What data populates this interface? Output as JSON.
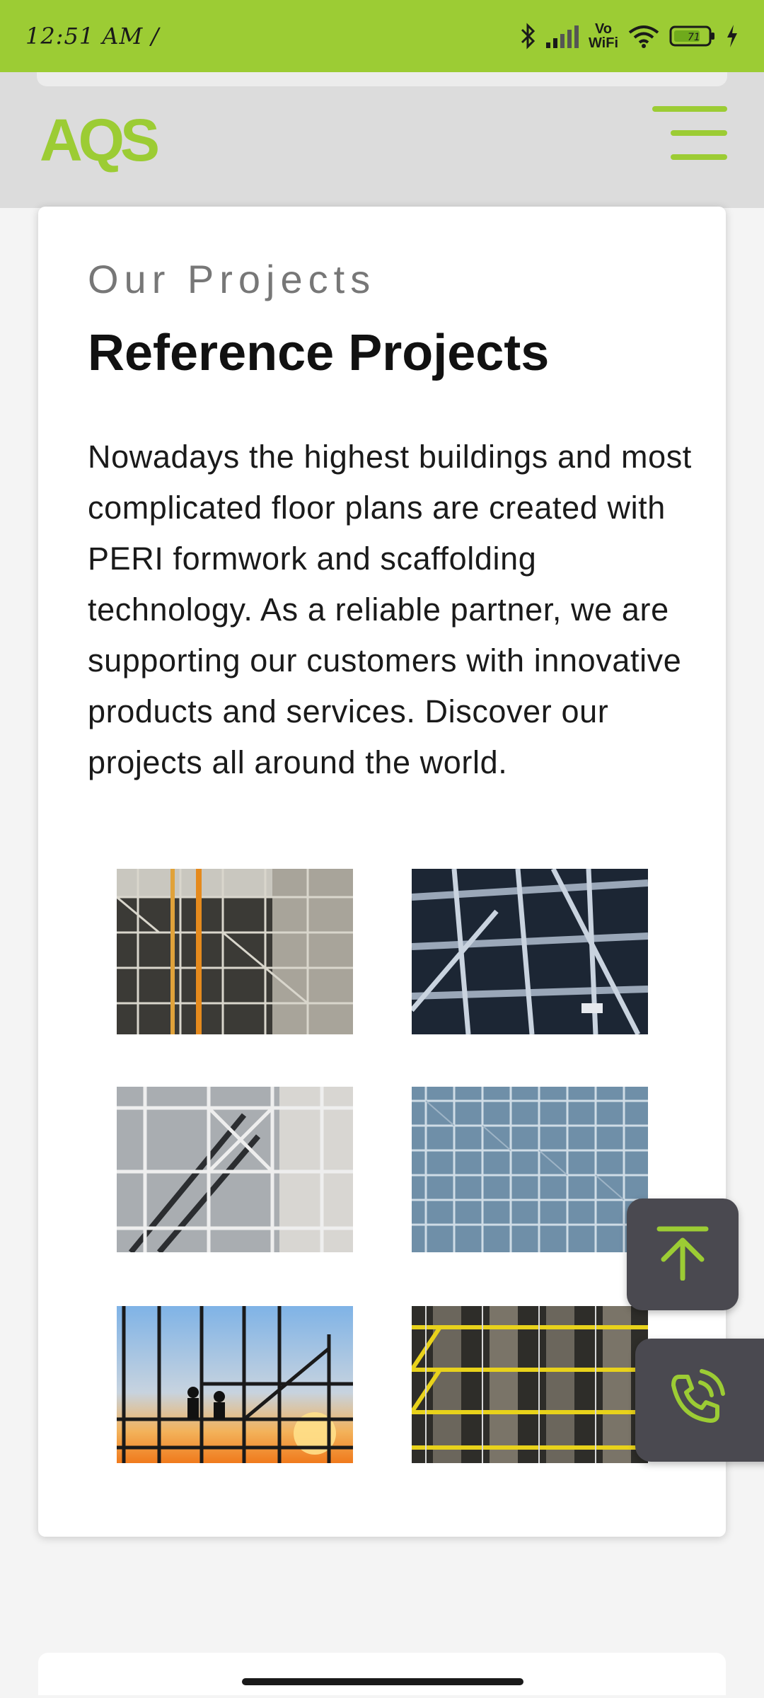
{
  "status_bar": {
    "time": "12:51 AM /",
    "network_label_top": "Vo",
    "network_label_bottom": "WiFi",
    "battery_level": "71",
    "icons": [
      "bluetooth-icon",
      "signal-icon",
      "vowifi-icon",
      "wifi-icon",
      "battery-icon",
      "charging-icon"
    ]
  },
  "header": {
    "logo_text": "AQS",
    "menu_icon": "hamburger-menu-icon"
  },
  "section": {
    "eyebrow": "Our Projects",
    "title": "Reference Projects",
    "description": "Nowadays the highest buildings and most complicated floor plans are created with PERI formwork and scaffolding technology. As a reliable partner, we are supporting our customers with innovative products and services. Discover our projects all around the world."
  },
  "gallery": [
    {
      "name": "scaffolding-building-photo"
    },
    {
      "name": "steel-pipe-structure-photo"
    },
    {
      "name": "scaffolding-stairs-photo"
    },
    {
      "name": "scaffolding-facade-photo"
    },
    {
      "name": "workers-sunset-scaffold-photo"
    },
    {
      "name": "yellow-scaffold-photo"
    }
  ],
  "floating_buttons": {
    "scroll_top_icon": "arrow-up-icon",
    "call_icon": "phone-call-icon"
  },
  "colors": {
    "accent": "#9ccc34",
    "fab_background": "#4a4950",
    "header_background": "#dcdcdc"
  }
}
